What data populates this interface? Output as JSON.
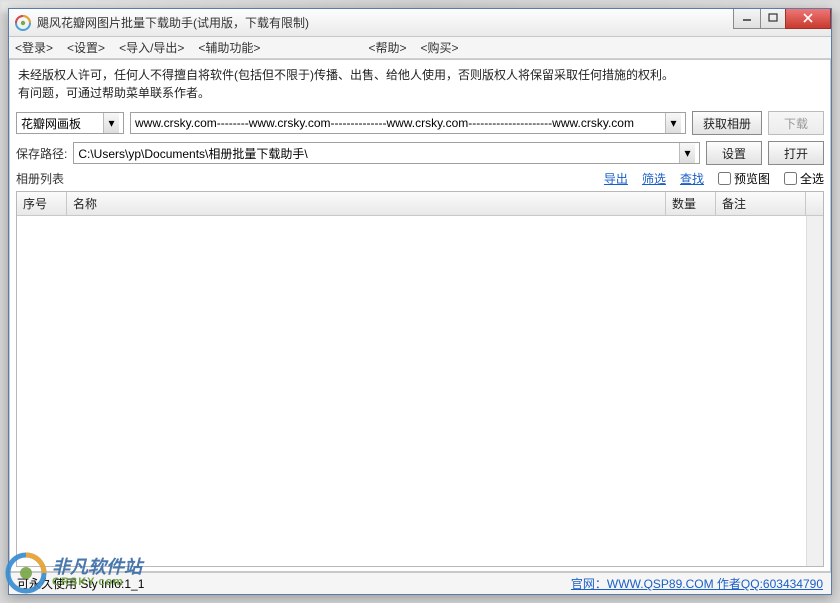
{
  "window": {
    "title": "飓风花瓣网图片批量下载助手(试用版，下载有限制)"
  },
  "menu": {
    "login": "<登录>",
    "settings": "<设置>",
    "io": "<导入/导出>",
    "aux": "<辅助功能>",
    "help": "<帮助>",
    "buy": "<购买>"
  },
  "notice": {
    "line1": "未经版权人许可，任何人不得擅自将软件(包括但不限于)传播、出售、给他人使用，否则版权人将保留采取任何措施的权利。",
    "line2": "有问题，可通过帮助菜单联系作者。"
  },
  "source": {
    "selected": "花瓣网画板",
    "url": "www.crsky.com--------www.crsky.com--------------www.crsky.com---------------------www.crsky.com",
    "fetch_btn": "获取相册",
    "download_btn": "下载"
  },
  "path": {
    "label": "保存路径:",
    "value": "C:\\Users\\yp\\Documents\\相册批量下载助手\\",
    "settings_btn": "设置",
    "open_btn": "打开"
  },
  "list": {
    "label": "相册列表",
    "export": "导出",
    "filter": "筛选",
    "find": "查找",
    "preview": "预览图",
    "select_all": "全选"
  },
  "table": {
    "col_num": "序号",
    "col_name": "名称",
    "col_qty": "数量",
    "col_remark": "备注"
  },
  "status": {
    "left": "可永久使用      Sty Info:1_1",
    "right": "官网：WWW.QSP89.COM 作者QQ:603434790"
  },
  "watermark": {
    "text": "非凡软件站",
    "sub": "CRSKY.com"
  }
}
